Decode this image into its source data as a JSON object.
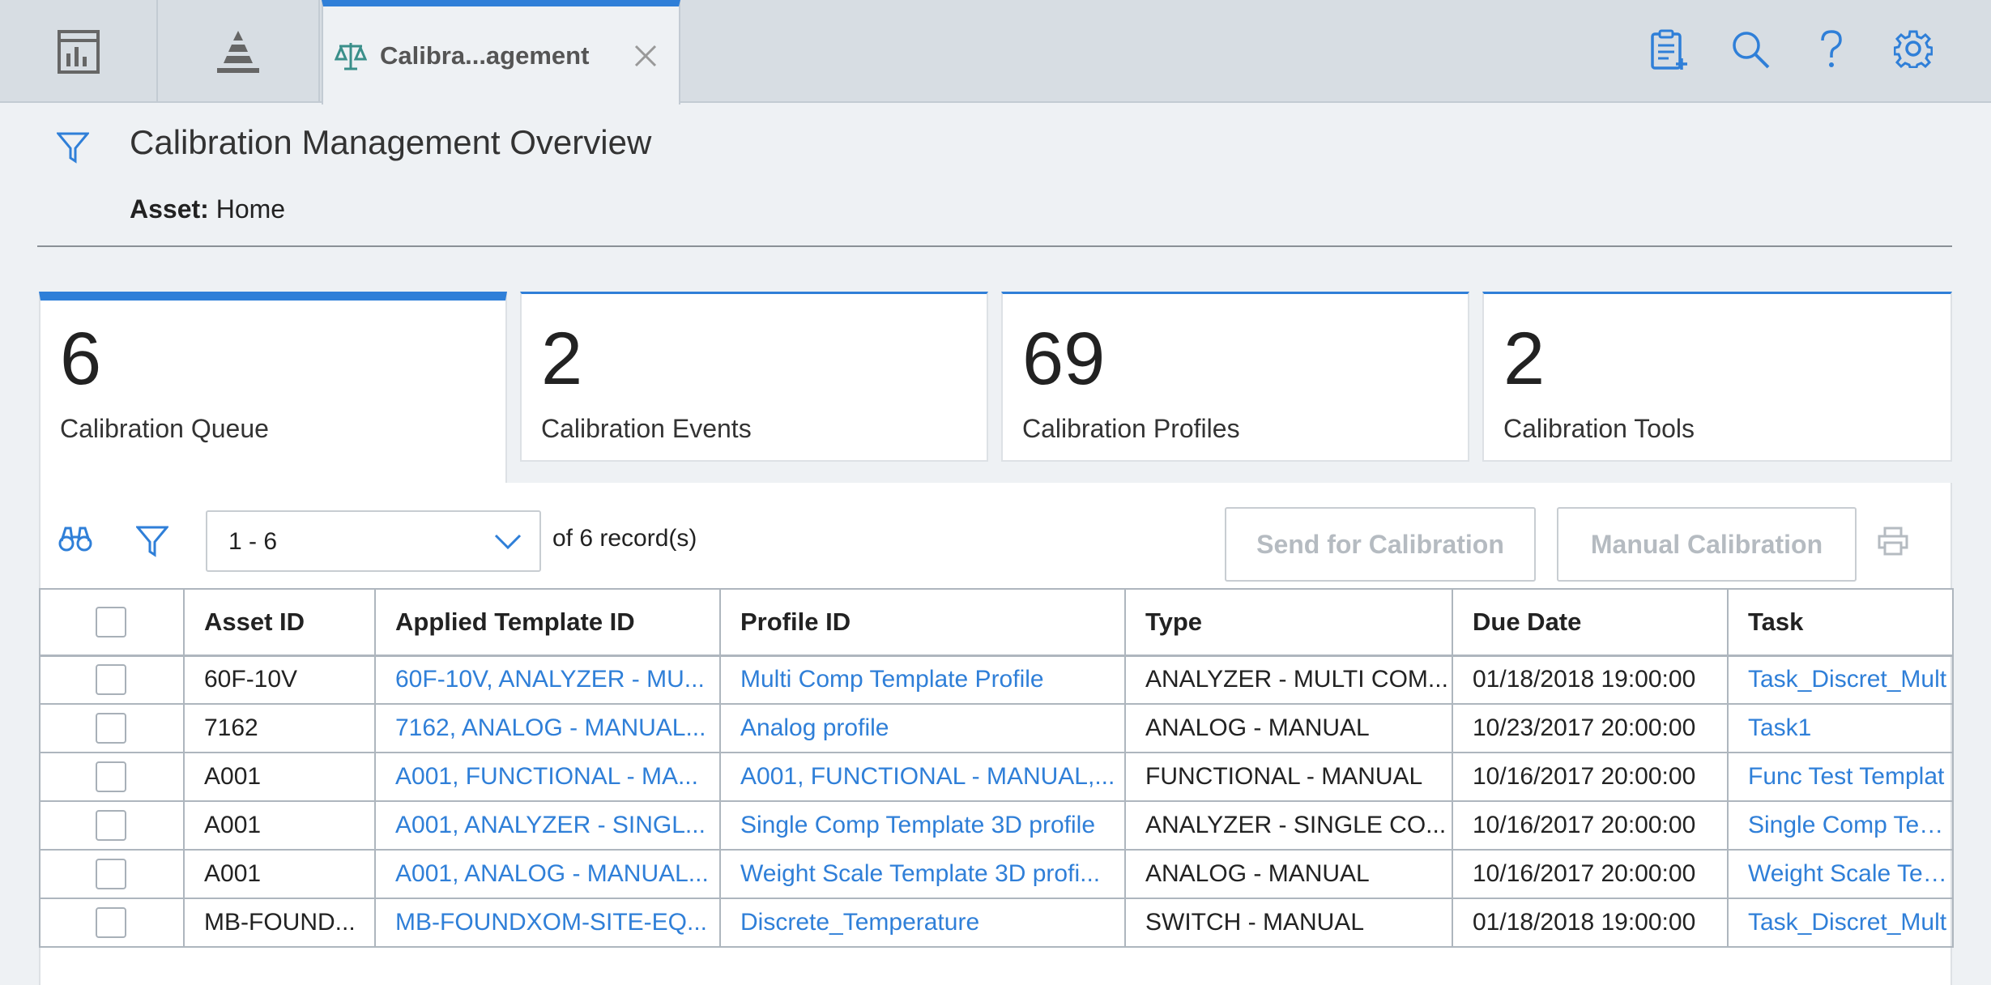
{
  "topbar": {
    "active_tab": {
      "label": "Calibra...agement",
      "icon": "scales-icon"
    },
    "nav_icons": [
      "dashboard-icon",
      "pyramid-icon"
    ],
    "tool_icons": [
      "clipboard-add-icon",
      "search-icon",
      "help-icon",
      "gear-icon"
    ]
  },
  "header": {
    "title": "Calibration Management Overview",
    "asset_label": "Asset:",
    "asset_value": "Home"
  },
  "cards": [
    {
      "count": "6",
      "label": "Calibration Queue"
    },
    {
      "count": "2",
      "label": "Calibration Events"
    },
    {
      "count": "69",
      "label": "Calibration Profiles"
    },
    {
      "count": "2",
      "label": "Calibration Tools"
    }
  ],
  "toolbar": {
    "page_range": "1 - 6",
    "records_text": "of 6 record(s)",
    "send_button": "Send for Calibration",
    "manual_button": "Manual Calibration"
  },
  "table": {
    "columns": [
      "Asset ID",
      "Applied Template ID",
      "Profile ID",
      "Type",
      "Due Date",
      "Task"
    ],
    "rows": [
      [
        "60F-10V",
        "60F-10V, ANALYZER - MU...",
        "Multi Comp Template Profile",
        "ANALYZER - MULTI COM...",
        "01/18/2018 19:00:00",
        "Task_Discret_Mult"
      ],
      [
        "7162",
        "7162, ANALOG - MANUAL...",
        "Analog profile",
        "ANALOG - MANUAL",
        "10/23/2017 20:00:00",
        "Task1"
      ],
      [
        "A001",
        "A001, FUNCTIONAL - MA...",
        "A001, FUNCTIONAL - MANUAL,...",
        "FUNCTIONAL - MANUAL",
        "10/16/2017 20:00:00",
        "Func Test Templat"
      ],
      [
        "A001",
        "A001, ANALYZER - SINGL...",
        "Single Comp Template 3D profile",
        "ANALYZER - SINGLE CO...",
        "10/16/2017 20:00:00",
        "Single Comp Temp"
      ],
      [
        "A001",
        "A001, ANALOG - MANUAL...",
        "Weight Scale Template 3D profi...",
        "ANALOG - MANUAL",
        "10/16/2017 20:00:00",
        "Weight Scale Temp"
      ],
      [
        "MB-FOUND...",
        "MB-FOUNDXOM-SITE-EQ...",
        "Discrete_Temperature",
        "SWITCH - MANUAL",
        "01/18/2018 19:00:00",
        "Task_Discret_Mult"
      ]
    ]
  },
  "colors": {
    "accent": "#2f7fd8",
    "link": "#2f7fd8",
    "topbar_bg": "#d7dde3",
    "page_bg": "#eef1f4",
    "disabled_text": "#b5bbc1"
  }
}
